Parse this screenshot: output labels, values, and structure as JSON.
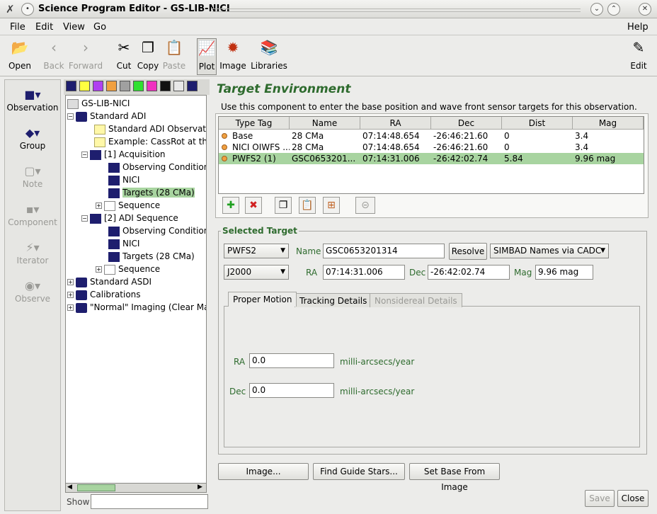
{
  "window": {
    "title": "Science Program Editor - GS-LIB-NICI"
  },
  "menus": [
    "File",
    "Edit",
    "View",
    "Go"
  ],
  "help_menu": "Help",
  "toolbar": {
    "open": "Open",
    "back": "Back",
    "forward": "Forward",
    "cut": "Cut",
    "copy": "Copy",
    "paste": "Paste",
    "plot": "Plot",
    "image": "Image",
    "libraries": "Libraries",
    "edit": "Edit"
  },
  "leftbar": [
    "Observation",
    "Group",
    "Note",
    "Component",
    "Iterator",
    "Observe"
  ],
  "tree": {
    "root": "GS-LIB-NICI",
    "nodes": [
      "Standard ADI",
      "Standard ADI Observati",
      "Example: CassRot at th",
      "[1] Acquisition",
      "Observing Condition",
      "NICI",
      "Targets (28 CMa)",
      "Sequence",
      "[2] ADI Sequence",
      "Observing Condition",
      "NICI",
      "Targets (28 CMa)",
      "Sequence",
      "Standard ASDI",
      "Calibrations",
      "\"Normal\" Imaging (Clear Ma"
    ],
    "show_label": "Show"
  },
  "main": {
    "title": "Target Environment",
    "description": "Use this component to enter the base position and wave front sensor targets for this observation.",
    "table": {
      "headers": [
        "Type Tag",
        "Name",
        "RA",
        "Dec",
        "Dist",
        "Mag"
      ],
      "rows": [
        [
          "Base",
          "28 CMa",
          "07:14:48.654",
          "-26:46:21.60",
          "0",
          "3.4"
        ],
        [
          "NICI OIWFS ...",
          "28 CMa",
          "07:14:48.654",
          "-26:46:21.60",
          "0",
          "3.4"
        ],
        [
          "PWFS2 (1)",
          "GSC0653201...",
          "07:14:31.006",
          "-26:42:02.74",
          "5.84",
          "9.96 mag"
        ]
      ]
    },
    "selected_target": {
      "legend": "Selected Target",
      "type": "PWFS2",
      "name_label": "Name",
      "name_value": "GSC0653201314",
      "resolve_label": "Resolve",
      "catalog": "SIMBAD Names via CADC",
      "coord_system": "J2000",
      "ra_label": "RA",
      "ra_value": "07:14:31.006",
      "dec_label": "Dec",
      "dec_value": "-26:42:02.74",
      "mag_label": "Mag",
      "mag_value": "9.96 mag"
    },
    "tabs": [
      "Proper Motion",
      "Tracking Details",
      "Nonsidereal Details"
    ],
    "proper_motion": {
      "ra_label": "RA",
      "ra_value": "0.0",
      "dec_label": "Dec",
      "dec_value": "0.0",
      "unit": "milli-arcsecs/year"
    },
    "buttons": {
      "image": "Image...",
      "find_guide_stars": "Find Guide Stars...",
      "set_base": "Set Base From Image"
    },
    "footer": {
      "save": "Save",
      "close": "Close"
    }
  }
}
